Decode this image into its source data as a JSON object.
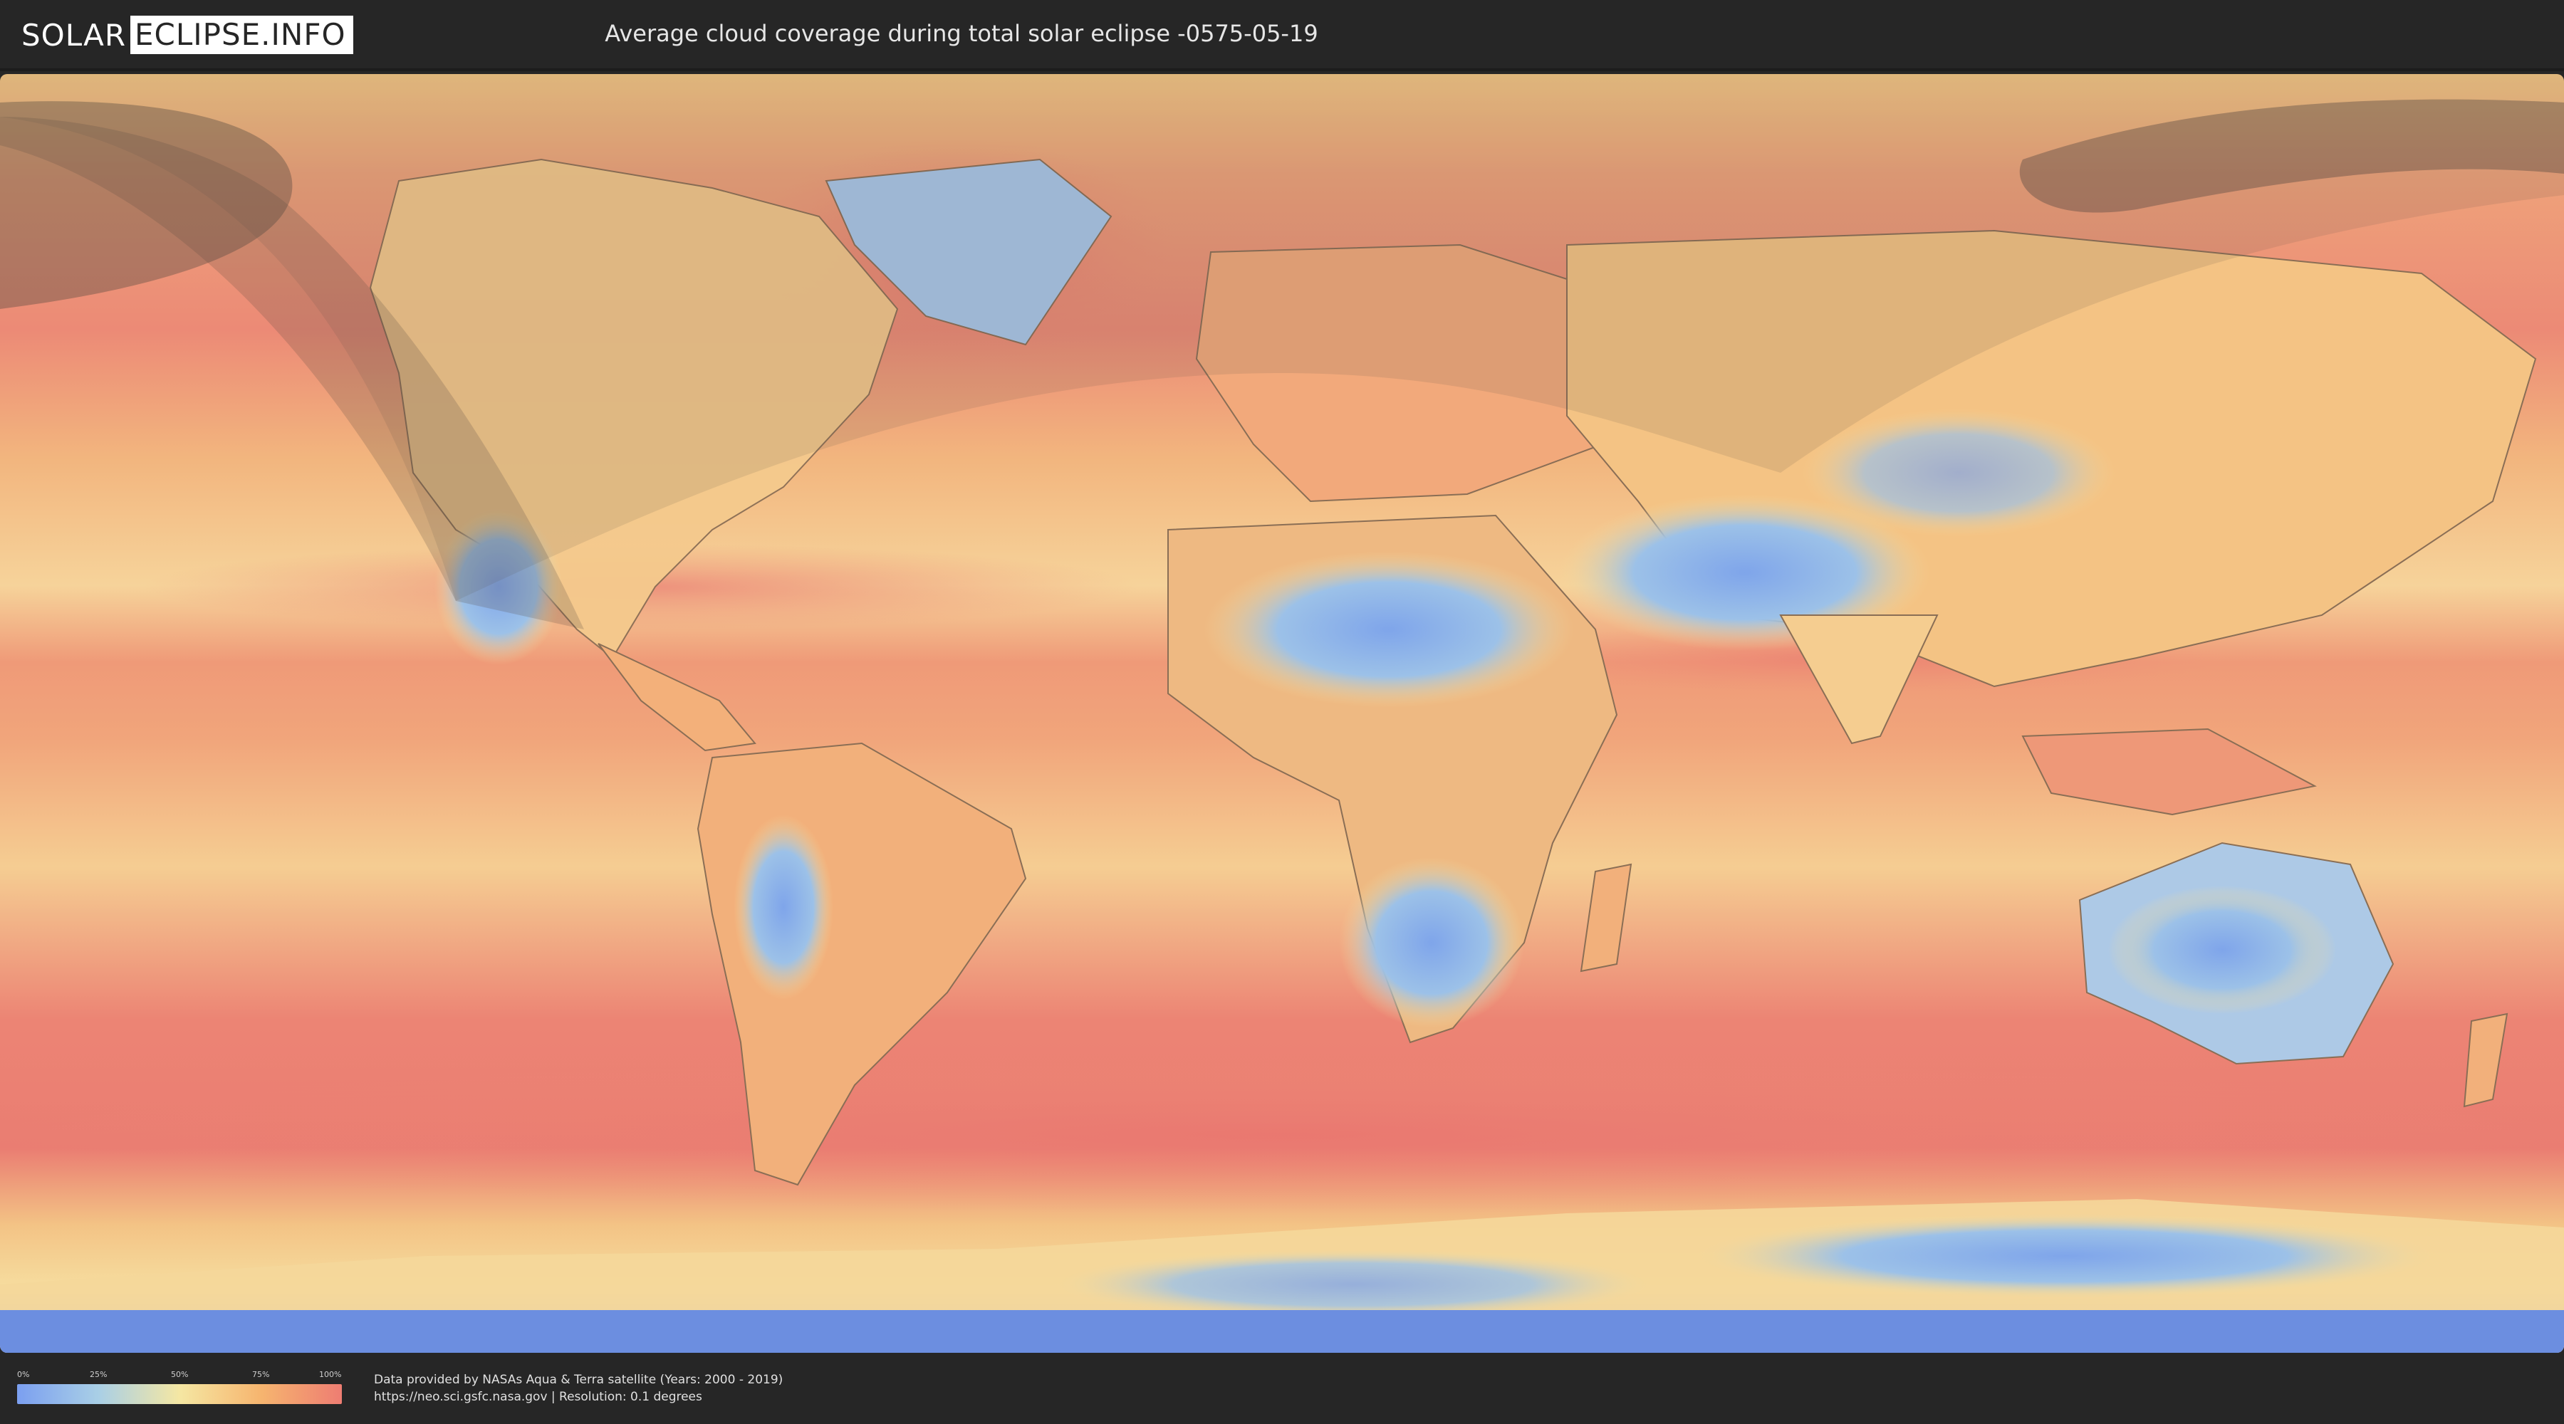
{
  "header": {
    "logo_part1": "SOLAR",
    "logo_part2": "ECLIPSE.INFO",
    "title": "Average cloud coverage during total solar eclipse -0575-05-19"
  },
  "legend": {
    "ticks": [
      "0%",
      "25%",
      "50%",
      "75%",
      "100%"
    ],
    "gradient_colors": [
      "#7b9ff0",
      "#a9cfe6",
      "#f5e7a3",
      "#f6b56f",
      "#ee7d72"
    ]
  },
  "credits": {
    "line1": "Data provided by NASAs Aqua & Terra satellite (Years: 2000 - 2019)",
    "line2": "https://neo.sci.gsfc.nasa.gov | Resolution: 0.1 degrees"
  },
  "colors": {
    "ocean_cloudy": "#ec8375",
    "mid": "#f5bb78",
    "clear": "#86aae6",
    "pale": "#f6e1a0",
    "shadow_overlay": "#5a5048",
    "background": "#262626"
  },
  "icons": {
    "logo_notch": "eclipse-notch-icon"
  }
}
